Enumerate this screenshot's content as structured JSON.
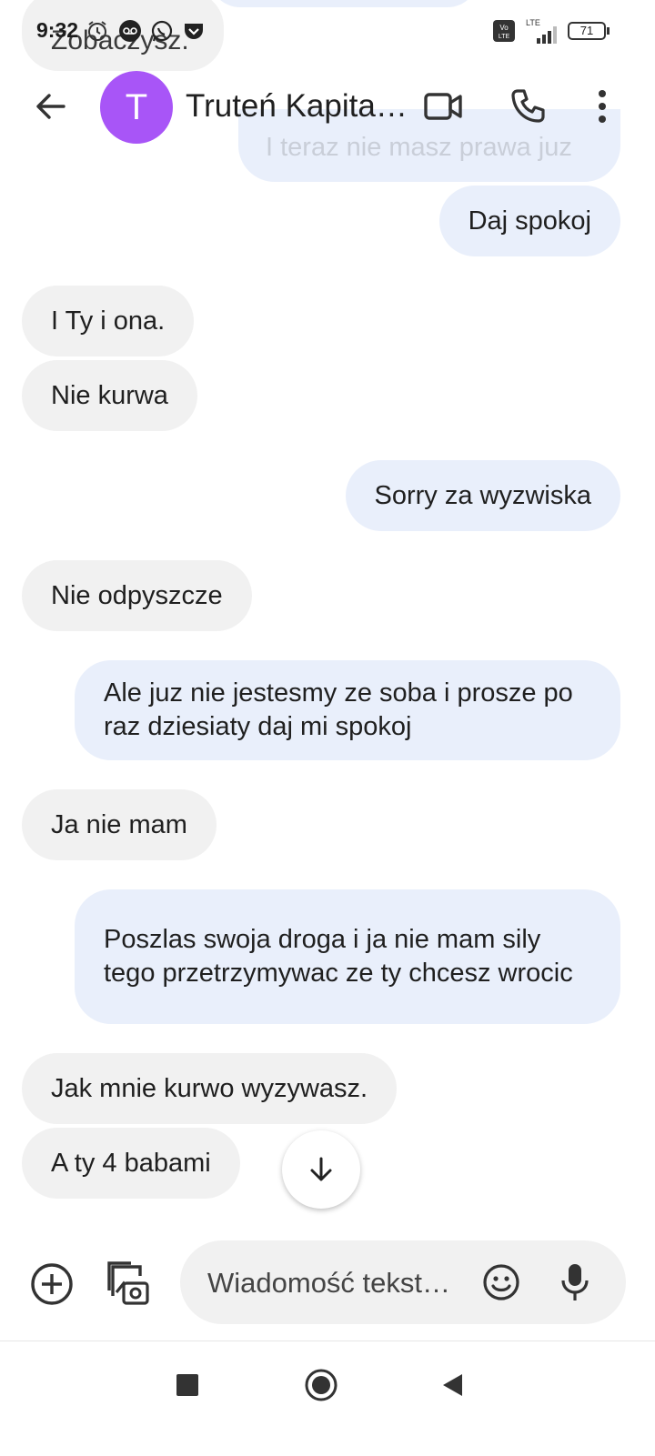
{
  "status_bar": {
    "time": "9:32",
    "battery": "71",
    "network_label": "LTE",
    "volte_label": "Vo LTE"
  },
  "conversation": {
    "contact_initial": "T",
    "contact_name": "Truteń Kapita…",
    "avatar_color": "#a855f7"
  },
  "hidden_messages": {
    "incoming": "Zobaczysz.",
    "outgoing": "I teraz nie masz prawa juz"
  },
  "messages": [
    {
      "dir": "out",
      "text": "Daj spokoj"
    },
    {
      "dir": "in",
      "text": "I Ty i ona."
    },
    {
      "dir": "in",
      "text": "Nie kurwa"
    },
    {
      "dir": "out",
      "text": "Sorry za wyzwiska"
    },
    {
      "dir": "in",
      "text": "Nie odpyszcze"
    },
    {
      "dir": "out",
      "text": "Ale juz nie jestesmy ze soba i prosze po raz dziesiaty daj mi spokoj"
    },
    {
      "dir": "in",
      "text": "Ja nie mam"
    },
    {
      "dir": "out",
      "text": "Poszlas swoja droga i ja nie mam sily tego przetrzymywac ze ty chcesz wrocic"
    },
    {
      "dir": "in",
      "text": "Jak mnie kurwo wyzywasz."
    },
    {
      "dir": "in",
      "text": "A ty 4 babami"
    }
  ],
  "compose": {
    "placeholder": "Wiadomość tekst…"
  },
  "colors": {
    "incoming_bubble": "#f1f1f1",
    "outgoing_bubble": "#e9effb",
    "icon": "#333333"
  }
}
